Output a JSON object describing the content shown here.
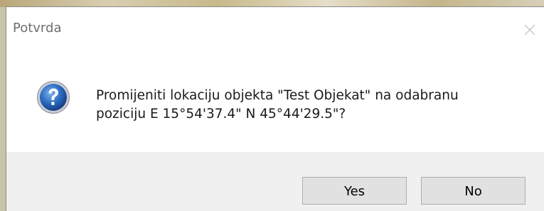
{
  "dialog": {
    "title": "Potvrda",
    "message_line1": "Promijeniti lokaciju objekta \"Test Objekat\" na odabranu",
    "message_line2": "poziciju E 15°54'37.4\" N 45°44'29.5\"?",
    "icon": "question-icon",
    "close_icon": "close-icon"
  },
  "buttons": {
    "yes_label": "Yes",
    "no_label": "No"
  },
  "colors": {
    "dialog_background": "#ffffff",
    "button_bar_background": "#f0f0f0",
    "button_face": "#e1e1e1",
    "icon_blue": "#1d5fb5"
  }
}
